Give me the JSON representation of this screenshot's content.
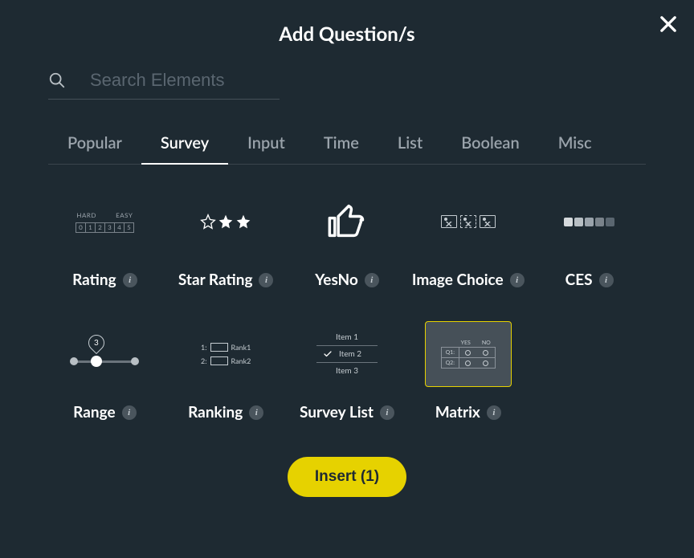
{
  "title": "Add Question/s",
  "search": {
    "placeholder": "Search Elements",
    "value": ""
  },
  "tabs": [
    {
      "label": "Popular",
      "active": false
    },
    {
      "label": "Survey",
      "active": true
    },
    {
      "label": "Input",
      "active": false
    },
    {
      "label": "Time",
      "active": false
    },
    {
      "label": "List",
      "active": false
    },
    {
      "label": "Boolean",
      "active": false
    },
    {
      "label": "Misc",
      "active": false
    }
  ],
  "elements": [
    {
      "label": "Rating",
      "selected": false
    },
    {
      "label": "Star Rating",
      "selected": false
    },
    {
      "label": "YesNo",
      "selected": false
    },
    {
      "label": "Image Choice",
      "selected": false
    },
    {
      "label": "CES",
      "selected": false
    },
    {
      "label": "Range",
      "selected": false
    },
    {
      "label": "Ranking",
      "selected": false
    },
    {
      "label": "Survey List",
      "selected": false
    },
    {
      "label": "Matrix",
      "selected": true
    }
  ],
  "rating_thumb": {
    "left": "HARD",
    "right": "EASY",
    "cells": [
      "0",
      "1",
      "2",
      "3",
      "4",
      "5"
    ]
  },
  "range_thumb": {
    "pin": "3"
  },
  "ranking_thumb": [
    {
      "num": "1:",
      "label": "Rank1"
    },
    {
      "num": "2:",
      "label": "Rank2"
    }
  ],
  "survey_list_thumb": {
    "items": [
      "Item 1",
      "Item 2",
      "Item 3"
    ]
  },
  "matrix_thumb": {
    "cols": [
      "YES",
      "NO"
    ],
    "rows": [
      "Q1:",
      "Q2:"
    ]
  },
  "insert_label": "Insert (1)"
}
